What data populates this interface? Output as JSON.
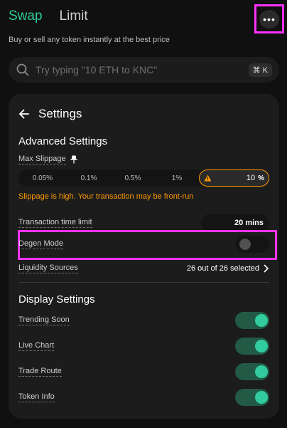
{
  "tabs": [
    {
      "label": "Swap",
      "active": true
    },
    {
      "label": "Limit",
      "active": false
    }
  ],
  "more_button": {
    "glyph": "•••",
    "icon": "more-horizontal-icon"
  },
  "subtitle": "Buy or sell any token instantly at the best price",
  "search": {
    "placeholder": "Try typing \"10 ETH to KNC\"",
    "value": "",
    "shortcut": "⌘ K",
    "icon": "search-icon"
  },
  "settings": {
    "title": "Settings",
    "back_icon": "arrow-left-icon",
    "advanced": {
      "title": "Advanced Settings",
      "max_slippage_label": "Max Slippage",
      "pin_icon": "pin-icon",
      "slippage_options": [
        "0.05%",
        "0.1%",
        "0.5%",
        "1%"
      ],
      "custom_slippage_value": "10",
      "custom_slippage_unit": "%",
      "warning_icon": "warning-triangle-icon",
      "warning_text": "Slippage is high. Your transaction may be front-run",
      "time_limit_label": "Transaction time limit",
      "time_limit_value": "20 mins",
      "degen_mode_label": "Degen Mode",
      "degen_mode_on": false,
      "liquidity_label": "Liquidity Sources",
      "liquidity_value": "26 out of 26 selected"
    },
    "display": {
      "title": "Display Settings",
      "items": [
        {
          "label": "Trending Soon",
          "on": true
        },
        {
          "label": "Live Chart",
          "on": true
        },
        {
          "label": "Trade Route",
          "on": true
        },
        {
          "label": "Token Info",
          "on": true
        }
      ]
    }
  },
  "colors": {
    "accent": "#31cb9e",
    "warning": "#ff9901",
    "highlight": "#ff33ff",
    "background": "#101010",
    "panel": "#1c1c1c"
  }
}
